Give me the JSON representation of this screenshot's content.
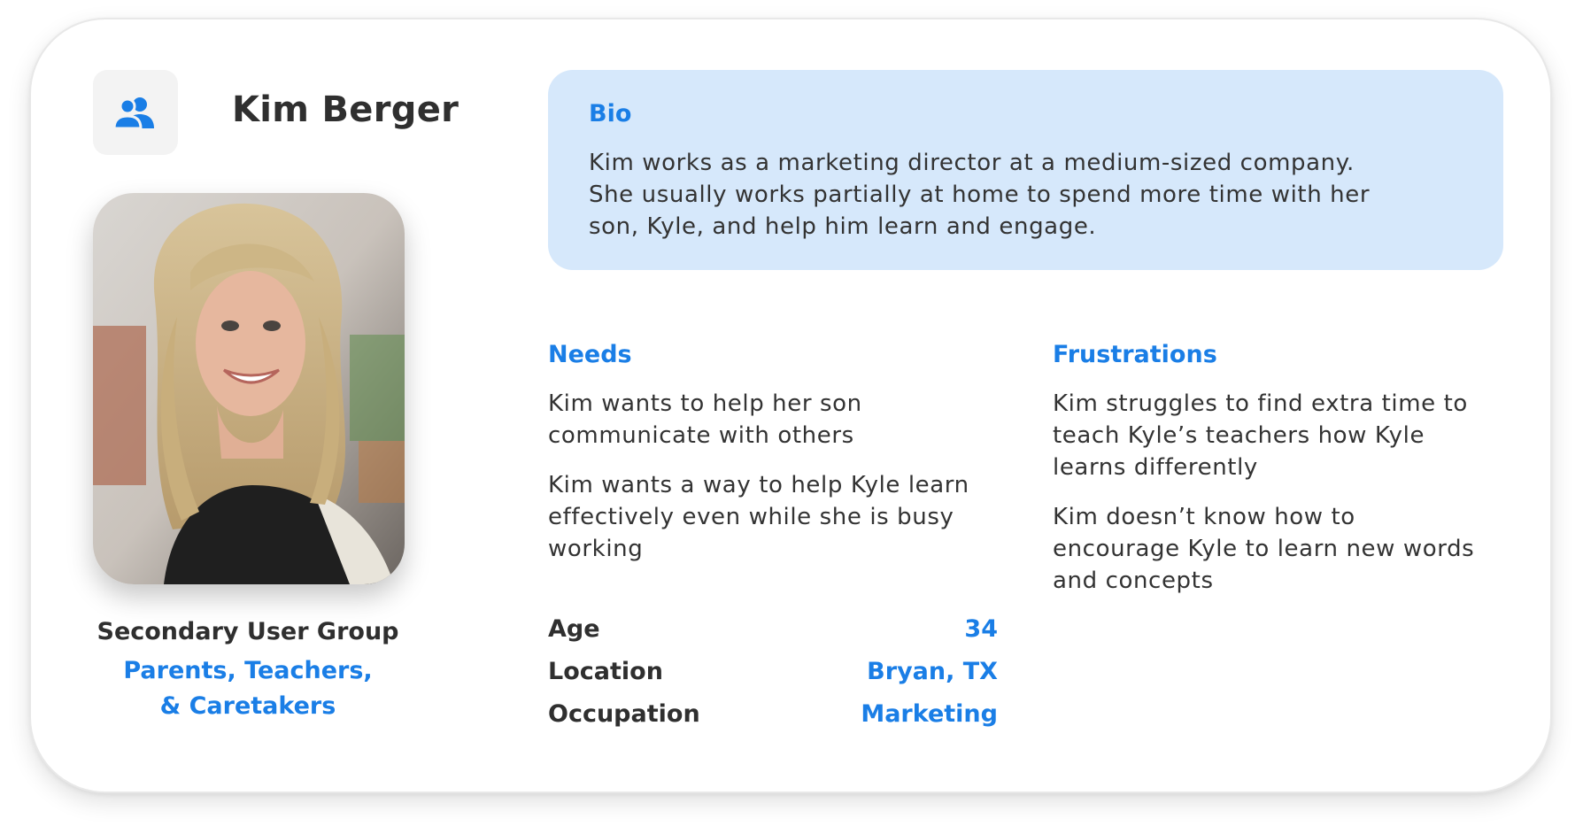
{
  "header": {
    "icon": "users-icon",
    "name": "Kim Berger"
  },
  "group": {
    "label": "Secondary User Group",
    "value_line1": "Parents, Teachers,",
    "value_line2": "& Caretakers"
  },
  "bio": {
    "title": "Bio",
    "lines": [
      "Kim works as a marketing director at a medium-sized company.",
      "She usually works partially at home to spend more time with her",
      "son, Kyle, and help him learn and engage."
    ]
  },
  "needs": {
    "title": "Needs",
    "items": [
      [
        "Kim wants to help her son",
        "communicate with others"
      ],
      [
        "Kim wants a way to help Kyle learn",
        "effectively even while she is busy",
        "working"
      ]
    ]
  },
  "frustrations": {
    "title": "Frustrations",
    "items": [
      [
        "Kim struggles to find extra time to",
        "teach Kyle’s teachers how Kyle",
        "learns differently"
      ],
      [
        "Kim doesn’t know how to",
        "encourage Kyle to learn new words",
        "and concepts"
      ]
    ]
  },
  "facts": [
    {
      "label": "Age",
      "value": "34"
    },
    {
      "label": "Location",
      "value": "Bryan, TX"
    },
    {
      "label": "Occupation",
      "value": "Marketing"
    }
  ],
  "colors": {
    "accent": "#1a7ee6",
    "bio_background": "#d6e8fb",
    "text": "#2f2f2f"
  }
}
